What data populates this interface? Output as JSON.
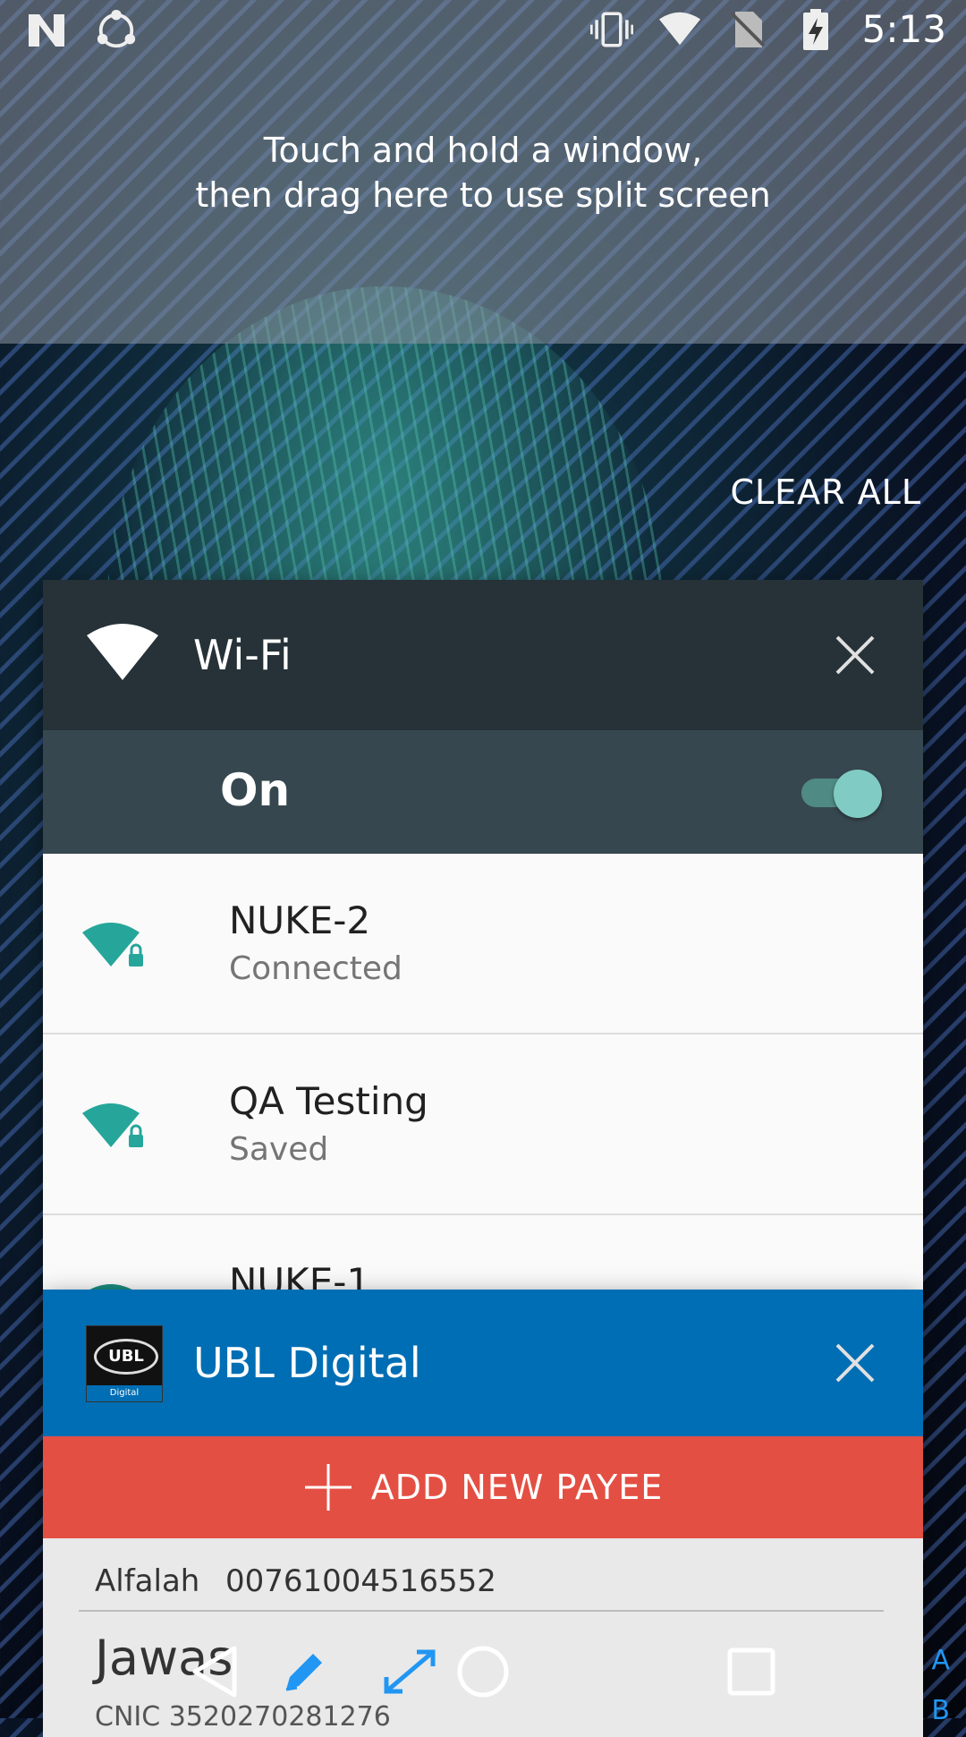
{
  "status_bar": {
    "left_icons": [
      "n-app-icon",
      "share-app-icon"
    ],
    "right_icons": [
      "vibrate-icon",
      "wifi-icon",
      "no-sim-icon",
      "battery-charging-icon"
    ],
    "time": "5:13"
  },
  "split_screen": {
    "line1": "Touch and hold a window,",
    "line2": "then drag here to use split screen"
  },
  "clear_all": "CLEAR ALL",
  "wifi_card": {
    "title": "Wi-Fi",
    "toggle_label": "On",
    "toggle_on": true,
    "networks": [
      {
        "name": "NUKE-2",
        "status": "Connected"
      },
      {
        "name": "QA Testing",
        "status": "Saved"
      },
      {
        "name": "NUKE-1",
        "status": ""
      }
    ]
  },
  "ubl_card": {
    "title": "UBL Digital",
    "add_payee": "ADD NEW PAYEE",
    "payee_bank": "Alfalah",
    "payee_account": "00761004516552",
    "payee_name": "Jawas",
    "payee_cnic": "CNIC 3520270281276",
    "alpha_index": [
      "A",
      "B"
    ]
  },
  "nav_bar": {
    "buttons": [
      "back",
      "edit",
      "expand",
      "home",
      "recents"
    ]
  },
  "colors": {
    "wifi_header": "#263238",
    "wifi_toggle_bar": "#37474f",
    "ubl_header": "#006eb4",
    "payee_bar": "#e44f43",
    "teal": "#26a69a"
  }
}
